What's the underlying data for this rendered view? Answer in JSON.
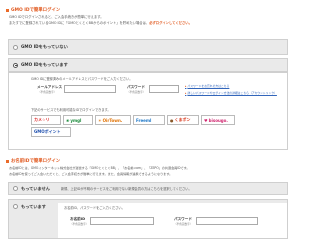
{
  "gmo_section": {
    "heading": "GMO IDで簡単ログイン",
    "description_lines": [
      "GMO IDでログインされると、ご入会手続きが簡単に行えます。",
      "またすでに登録されているGMO IDに「GMOとくとくBBからのポイント」を貯めたい場合は、"
    ],
    "description_emphasis": "必ずログインしてください。"
  },
  "option_no_id": {
    "label": "GMO IDをもっていない"
  },
  "option_have_id": {
    "label": "GMO IDをもっています",
    "instruction": "GMO IDに登録済みのメールアドレスとパスワードをご入力ください。",
    "email_label": "メールアドレス",
    "email_sub": "（半角英数字）",
    "password_label": "パスワード",
    "password_sub": "（半角英数字）",
    "forgot_link": "パスワードをお忘れの方はこちら",
    "more_link": "詳しいパスワードやログイン方法の詳細はこちら（アカウントリンク）",
    "partner_intro": "下記のサービスでも利用可能なIDでログインできます。",
    "partners": [
      {
        "name": "カメ☆リ",
        "color": "#d81e1e",
        "icon": "camera-icon"
      },
      {
        "name": "ymgl",
        "color": "#1a8a3a",
        "icon": "leaf-icon"
      },
      {
        "name": "OirTown.",
        "color": "#e07000",
        "icon": "sun-icon"
      },
      {
        "name": "Freeml",
        "color": "#1e78c8",
        "icon": "mail-icon"
      },
      {
        "name": "くまポン",
        "color": "#d83a1e",
        "icon": "bear-icon"
      },
      {
        "name": "bisougo.",
        "color": "#d0246e",
        "icon": "heart-icon"
      },
      {
        "name": "GMOポイント",
        "color": "#1e4fae",
        "icon": "gmo-icon"
      }
    ]
  },
  "existing_section": {
    "heading": "お名前IDで簡単ログイン",
    "description_lines": [
      "お名前IDとは、GMOインターネット株式会社が運営する「GMOとくとくBB」、「お名前.com」、「ZEPO」の共通会員IDです。",
      "お名前IDを使ってご入会いただくと、ご入会手続きが簡単に行えます。また、会員情報が連携できるようになります。"
    ]
  },
  "option_no_onamae": {
    "label": "もっていません",
    "note": "新規、上記IDが不明のサービスをご利用でない新規会員の方はこちらを選択してください。"
  },
  "option_have_onamae": {
    "label": "もっています",
    "instruction": "お名前ID、パスワードをご入力ください。",
    "id_label": "お名前ID",
    "id_sub": "（半角英数字）",
    "password_label": "パスワード",
    "password_sub": "（半角英数字）"
  },
  "colors": {
    "accent": "#e0561b",
    "link": "#3366bb",
    "panel_bg": "#eaeaea"
  }
}
